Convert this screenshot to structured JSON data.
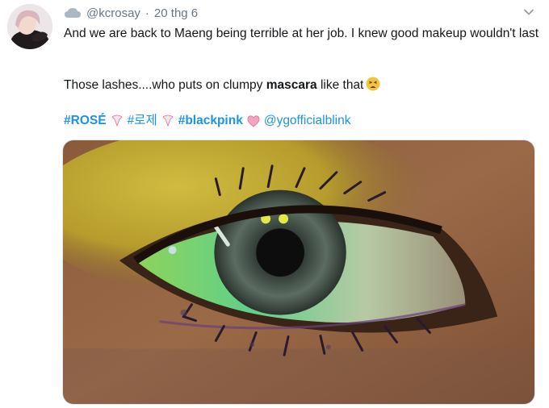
{
  "tweet": {
    "author": {
      "handle": "@kcrosay",
      "date": "20 thg 6"
    },
    "body": {
      "line1": "And we are back to Maeng being terrible at her job. I knew good makeup wouldn't last",
      "line2_prefix": "Those lashes....who puts on clumpy ",
      "line2_bold": "mascara",
      "line2_suffix": " like that"
    },
    "tags": {
      "t1": "#ROSÉ",
      "t2": "#로제",
      "t3": "#blackpink",
      "t4": "@ygofficialblink"
    },
    "separator": "·",
    "colors": {
      "link": "#1b95e0",
      "muted": "#657786",
      "text": "#14171a"
    },
    "icons": [
      "cloud-icon",
      "chevron-down-icon",
      "tired-face-emoji",
      "rose-hashflag-icon",
      "blackpink-heart-icon"
    ]
  }
}
